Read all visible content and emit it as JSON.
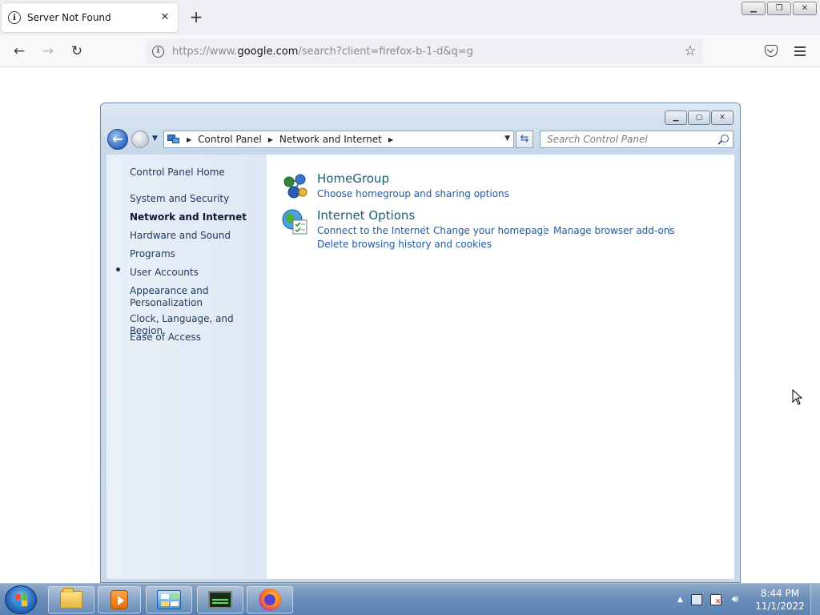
{
  "browser": {
    "tab_title": "Server Not Found",
    "url_prefix": "https://www.",
    "url_host": "google.com",
    "url_path": "/search?client=firefox-b-1-d&q=g",
    "icons": [
      "info-icon",
      "close-icon",
      "plus-icon",
      "back-arrow-icon",
      "forward-arrow-icon",
      "reload-icon",
      "star-icon",
      "pocket-icon",
      "menu-icon"
    ]
  },
  "control_panel": {
    "breadcrumbs": [
      "Control Panel",
      "Network and Internet"
    ],
    "search_placeholder": "Search Control Panel",
    "sidebar": {
      "items": [
        {
          "label": "Control Panel Home"
        },
        {
          "label": "System and Security"
        },
        {
          "label": "Network and Internet",
          "active": true
        },
        {
          "label": "Hardware and Sound"
        },
        {
          "label": "Programs"
        },
        {
          "label": "User Accounts"
        },
        {
          "label": "Appearance and Personalization"
        },
        {
          "label": "Clock, Language, and Region"
        },
        {
          "label": "Ease of Access"
        }
      ]
    },
    "categories": [
      {
        "title": "HomeGroup",
        "links": [
          "Choose homegroup and sharing options"
        ]
      },
      {
        "title": "Internet Options",
        "links": [
          "Connect to the Internet",
          "Change your homepage",
          "Manage browser add-ons",
          "Delete browsing history and cookies"
        ]
      }
    ]
  },
  "taskbar": {
    "time": "8:44 PM",
    "date": "11/1/2022"
  },
  "colors": {
    "link": "#1e5aa8",
    "category_title": "#1e5c6c",
    "sidebar_text": "#1e395b",
    "taskbar": "#6b8fba"
  }
}
